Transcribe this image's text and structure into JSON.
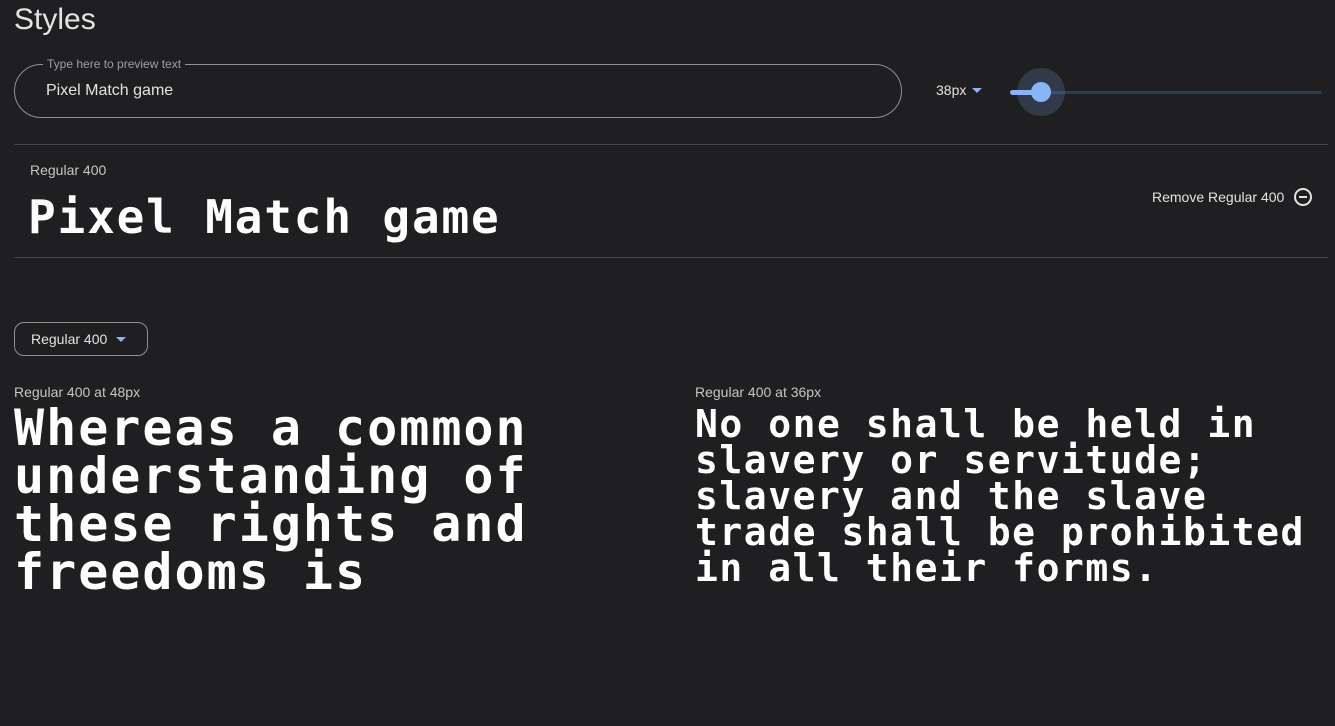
{
  "header": {
    "title": "Styles"
  },
  "preview": {
    "legend": "Type here to preview text",
    "value": "Pixel Match game"
  },
  "size_control": {
    "selected_size": "38px",
    "slider_value_fraction": 0.1
  },
  "style_row": {
    "label": "Regular 400",
    "preview_text": "Pixel Match game",
    "remove_label": "Remove Regular 400"
  },
  "style_selector": {
    "selected": "Regular 400"
  },
  "samples": [
    {
      "label": "Regular 400 at 48px",
      "text": "Whereas a common understanding of these rights and freedoms is"
    },
    {
      "label": "Regular 400 at 36px",
      "text": "No one shall be held in slavery or servitude; slavery and the slave trade shall be prohibited in all their forms."
    }
  ],
  "colors": {
    "accent": "#8ab4f8",
    "background": "#1f1f21",
    "text": "#e3e3e3"
  }
}
